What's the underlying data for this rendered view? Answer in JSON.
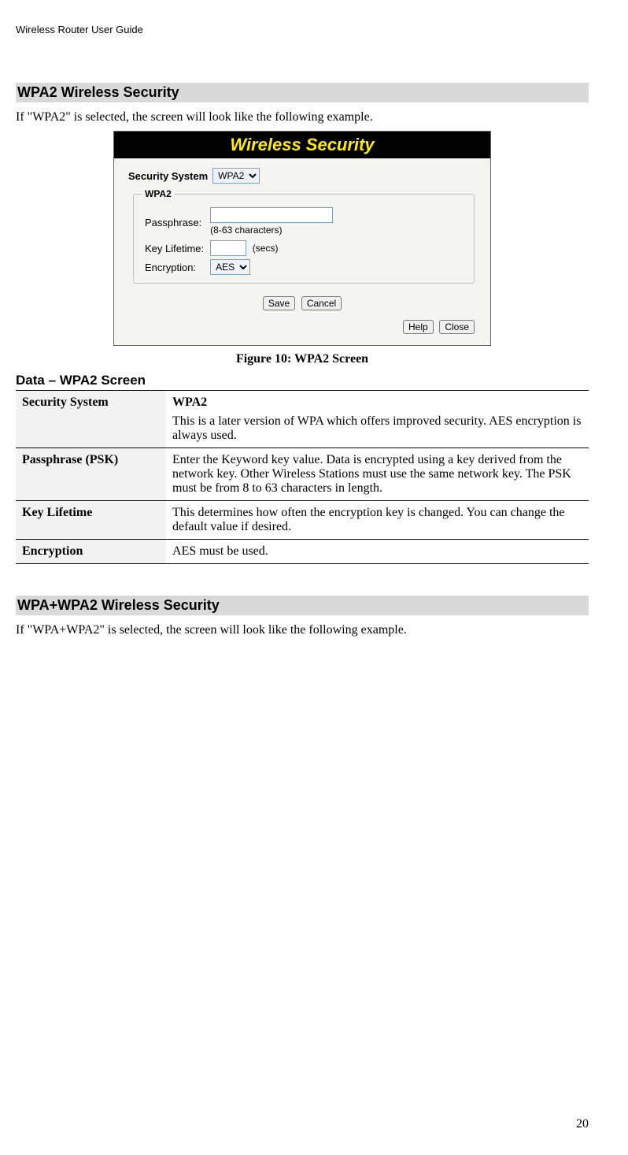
{
  "header": "Wireless Router User Guide",
  "section1": {
    "heading": "WPA2 Wireless Security",
    "intro": "If \"WPA2\" is selected, the screen will look like the following example."
  },
  "figure": {
    "titleBar": "Wireless Security",
    "securitySystemLabel": "Security System",
    "securitySystemValue": "WPA2",
    "groupLegend": "WPA2",
    "passphraseLabel": "Passphrase:",
    "passphraseHint": "(8-63 characters)",
    "keyLifetimeLabel": "Key Lifetime:",
    "keyLifetimeUnit": "(secs)",
    "encryptionLabel": "Encryption:",
    "encryptionValue": "AES",
    "saveBtn": "Save",
    "cancelBtn": "Cancel",
    "helpBtn": "Help",
    "closeBtn": "Close",
    "caption": "Figure 10: WPA2 Screen"
  },
  "dataSection": {
    "heading": "Data – WPA2 Screen",
    "rows": [
      {
        "key": "Security System",
        "valueHead": "WPA2",
        "valueBody": "This is a later version of WPA which offers improved security. AES encryption is always used."
      },
      {
        "key": "Passphrase (PSK)",
        "valueHead": "",
        "valueBody": "Enter the Keyword key value. Data is encrypted using a key derived from the network key. Other Wireless Stations must use the same network key. The PSK must be from 8 to 63 characters in length."
      },
      {
        "key": "Key Lifetime",
        "valueHead": "",
        "valueBody": "This determines how often the encryption key is changed. You can change the default value if desired."
      },
      {
        "key": "Encryption",
        "valueHead": "",
        "valueBody": "AES must be used."
      }
    ]
  },
  "section2": {
    "heading": "WPA+WPA2 Wireless Security",
    "intro": "If \"WPA+WPA2\" is selected, the screen will look like the following example."
  },
  "pageNumber": "20"
}
